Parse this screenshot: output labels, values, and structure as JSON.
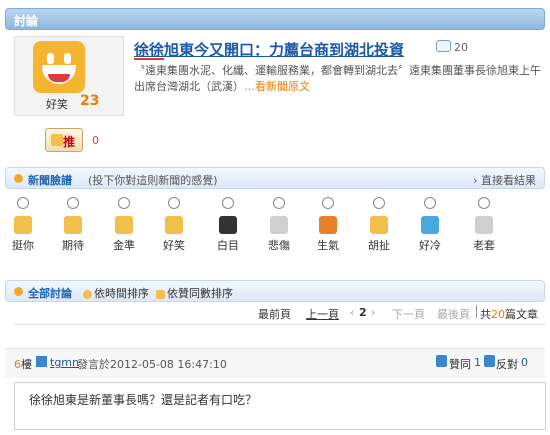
{
  "header": {
    "title": "討論"
  },
  "article": {
    "face_label": "好笑",
    "face_count": "23",
    "title": "徐徐旭東今又開口：力薦台商到湖北投資",
    "comment_count": "20",
    "snippet": "〝遠東集團水泥、化纖、運輸服務業，都會轉到湖北去〞遠東集團董事長徐旭東上午出席台灣湖北（武漢）",
    "more_link": "…看新聞原文",
    "push_label": "推",
    "push_count": "0"
  },
  "mood": {
    "title": "新聞臉譜",
    "subtitle": "(投下你對這則新聞的感覺)",
    "direct_link": "直接看結果",
    "options": [
      "挺你",
      "期待",
      "金準",
      "好笑",
      "白目",
      "悲傷",
      "生氣",
      "胡扯",
      "好冷",
      "老套"
    ],
    "colors": [
      "#f2c04a",
      "#f2c04a",
      "#f2c04a",
      "#f2c04a",
      "#333333",
      "#cfcfcf",
      "#e8802a",
      "#f2c04a",
      "#4aa8e0",
      "#cfcfcf"
    ]
  },
  "discussion": {
    "title": "全部討論",
    "sort_time": "依時間排序",
    "sort_votes": "依贊同數排序"
  },
  "pager": {
    "first": "最前頁",
    "prev": "上一頁",
    "current": "2",
    "next": "下一頁",
    "last": "最後頁",
    "total_prefix": "共",
    "total": "20",
    "total_suffix": "篇文章"
  },
  "post": {
    "floor": "6",
    "floor_suffix": "樓",
    "user": "tgmn",
    "time": "發言於2012-05-08 16:47:10",
    "agree_label": "贊同",
    "agree_count": "1",
    "oppose_label": "反對",
    "oppose_count": "0",
    "content": "徐徐旭東是新董事長嗎？還是記者有口吃？"
  }
}
